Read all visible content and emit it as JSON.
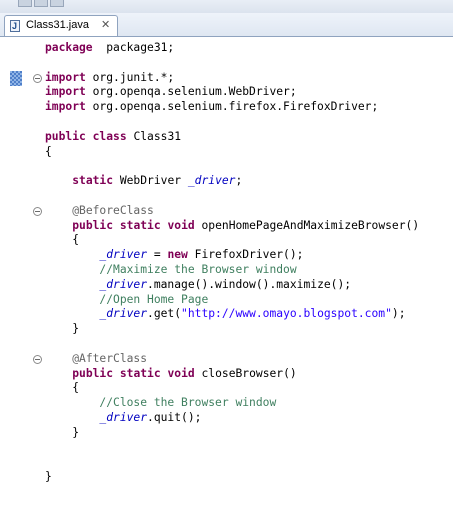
{
  "window": {
    "top_strip_icons": [
      "toolbar-icon",
      "toolbar-icon",
      "toolbar-icon"
    ]
  },
  "tab": {
    "title": "Class31.java",
    "close_glyph": "✕",
    "file_icon_letter": "J"
  },
  "colors": {
    "keyword": "#7f0055",
    "field": "#0000c0",
    "comment": "#3f7f5f",
    "string": "#2a00ff",
    "annotation": "#646464"
  },
  "code": {
    "lines": [
      [
        [
          "kw",
          "package"
        ],
        [
          "",
          "  package31;"
        ]
      ],
      [],
      [
        [
          "kw",
          "import"
        ],
        [
          "",
          " org.junit.*;"
        ]
      ],
      [
        [
          "kw",
          "import"
        ],
        [
          "",
          " org.openqa.selenium.WebDriver;"
        ]
      ],
      [
        [
          "kw",
          "import"
        ],
        [
          "",
          " org.openqa.selenium.firefox.FirefoxDriver;"
        ]
      ],
      [],
      [
        [
          "kw",
          "public"
        ],
        [
          "",
          " "
        ],
        [
          "kw",
          "class"
        ],
        [
          "",
          " Class31"
        ]
      ],
      [
        [
          "",
          "{"
        ]
      ],
      [],
      [
        [
          "",
          "    "
        ],
        [
          "kw",
          "static"
        ],
        [
          "",
          " WebDriver "
        ],
        [
          "fld",
          "_driver"
        ],
        [
          "",
          ";"
        ]
      ],
      [],
      [
        [
          "",
          "    "
        ],
        [
          "ann",
          "@BeforeClass"
        ]
      ],
      [
        [
          "",
          "    "
        ],
        [
          "kw",
          "public"
        ],
        [
          "",
          " "
        ],
        [
          "kw",
          "static"
        ],
        [
          "",
          " "
        ],
        [
          "kw",
          "void"
        ],
        [
          "",
          " openHomePageAndMaximizeBrowser()"
        ]
      ],
      [
        [
          "",
          "    {"
        ]
      ],
      [
        [
          "",
          "        "
        ],
        [
          "fld",
          "_driver"
        ],
        [
          "",
          " = "
        ],
        [
          "kw",
          "new"
        ],
        [
          "",
          " FirefoxDriver();"
        ]
      ],
      [
        [
          "",
          "        "
        ],
        [
          "cm",
          "//Maximize the Browser window"
        ]
      ],
      [
        [
          "",
          "        "
        ],
        [
          "fld",
          "_driver"
        ],
        [
          "",
          ".manage().window().maximize();"
        ]
      ],
      [
        [
          "",
          "        "
        ],
        [
          "cm",
          "//Open Home Page"
        ]
      ],
      [
        [
          "",
          "        "
        ],
        [
          "fld",
          "_driver"
        ],
        [
          "",
          ".get("
        ],
        [
          "str",
          "\"http://www.omayo.blogspot.com\""
        ],
        [
          "",
          ");"
        ]
      ],
      [
        [
          "",
          "    }"
        ]
      ],
      [],
      [
        [
          "",
          "    "
        ],
        [
          "ann",
          "@AfterClass"
        ]
      ],
      [
        [
          "",
          "    "
        ],
        [
          "kw",
          "public"
        ],
        [
          "",
          " "
        ],
        [
          "kw",
          "static"
        ],
        [
          "",
          " "
        ],
        [
          "kw",
          "void"
        ],
        [
          "",
          " closeBrowser()"
        ]
      ],
      [
        [
          "",
          "    {"
        ]
      ],
      [
        [
          "",
          "        "
        ],
        [
          "cm",
          "//Close the Browser window"
        ]
      ],
      [
        [
          "",
          "        "
        ],
        [
          "fld",
          "_driver"
        ],
        [
          "",
          ".quit();"
        ]
      ],
      [
        [
          "",
          "    }"
        ]
      ],
      [],
      [],
      [
        [
          "",
          "}"
        ]
      ]
    ]
  }
}
